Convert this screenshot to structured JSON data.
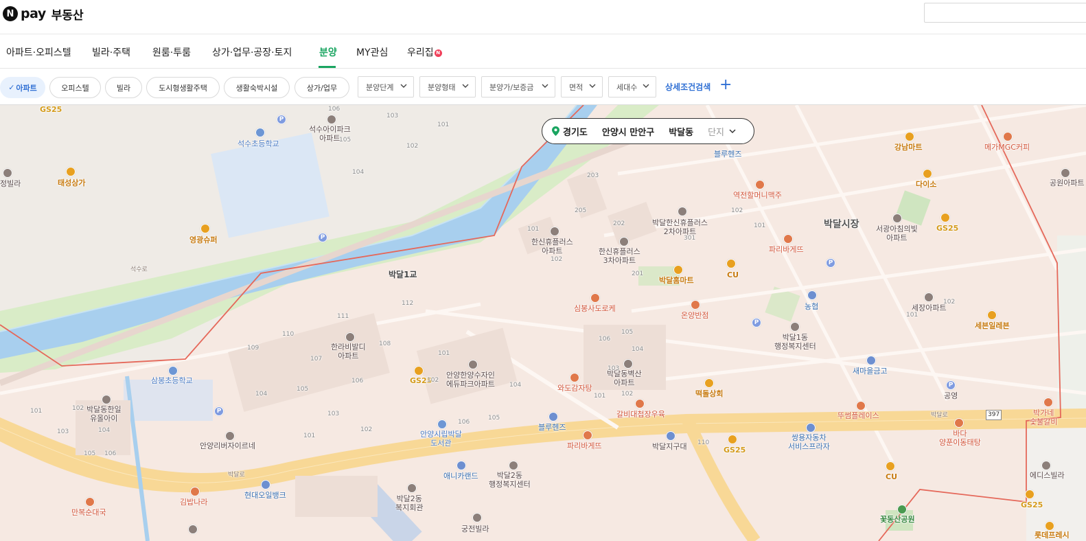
{
  "header": {
    "logo_n": "N",
    "logo_pay": "pay",
    "logo_title": "부동산",
    "search_placeholder": ""
  },
  "nav": {
    "items": [
      {
        "label": "아파트·오피스텔"
      },
      {
        "label": "빌라·주택"
      },
      {
        "label": "원룸·투룸"
      },
      {
        "label": "상가·업무·공장·토지"
      },
      {
        "label": "분양",
        "active": true
      },
      {
        "label": "MY관심"
      },
      {
        "label": "우리집",
        "badge": "N"
      }
    ]
  },
  "filters": {
    "types": [
      {
        "label": "아파트",
        "selected": true
      },
      {
        "label": "오피스텔"
      },
      {
        "label": "빌라"
      },
      {
        "label": "도시형생활주택"
      },
      {
        "label": "생활숙박시설"
      },
      {
        "label": "상가/업무"
      }
    ],
    "dropdowns": [
      {
        "label": "분양단계"
      },
      {
        "label": "분양형태"
      },
      {
        "label": "분양가/보증금"
      },
      {
        "label": "면적"
      },
      {
        "label": "세대수"
      }
    ],
    "detail_search": "상세조건검색",
    "accent": "#2f6fd4"
  },
  "location": {
    "province": "경기도",
    "city": "안양시 만안구",
    "dong": "박달동",
    "mode": "단지"
  },
  "map": {
    "labels": {
      "gs25_1": "GS25",
      "gs25_2": "GS25",
      "gs25_3": "GS25",
      "gs25_4": "GS25",
      "gs25_5": "GS25",
      "seoksu_school": "석수초등학교",
      "seoksu_ipark": "석수아이파크\n아파트",
      "taesung": "태성상가",
      "jeongbilla": "정빌라",
      "younggwang": "영광슈퍼",
      "bakdal1gyo": "박달1교",
      "hansin_apt": "한신휴플러스\n아파트",
      "hansin3": "한신휴플러스\n3차아파트",
      "bakdal_hansin2": "박달한신휴플러스\n2차아파트",
      "bakdal_home": "박달홈마트",
      "cu1": "CU",
      "cu2": "CU",
      "simbong": "심봉사도로케",
      "onyang": "온양반점",
      "nonghyup": "농협",
      "bakdal1dong": "박달1동\n행정복지센터",
      "saemaeul": "새마을금고",
      "bakdal_market": "박달시장",
      "seoguang": "서광아침의빛\n아파트",
      "sejang": "세장아파트",
      "seven": "세븐일레븐",
      "dasso": "다이소",
      "gangnam": "강남마트",
      "mega": "메가MGC커피",
      "gongwon": "공원아파트",
      "bluehens1": "블루헨즈",
      "yeokjeon": "역전할머니맥주",
      "paris1": "파리바게뜨",
      "paris2": "파리바게뜨",
      "samsung_school": "삼봉초등학교",
      "bakdal_hanil": "박달동한일\n유올아이",
      "hanra": "한라비발디\n아파트",
      "anyang_hanyang": "안양한양수자인\n에듀파크아파트",
      "bakdal_byeoksan": "박달동벽산\n아파트",
      "wado": "와도감자탕",
      "galbi": "갈비대첩장우육",
      "ddeokdol": "떡돌상회",
      "tous": "뚜썸플레이스",
      "ssangyong": "쌍용자동차\n서비스프라자",
      "gongyoung": "공영",
      "bakganae": "박가네\n숯불갈비",
      "bada": "바다\n양푼이동태탕",
      "anyang_library": "안양시립박달\n도서관",
      "bluehens2": "블루헨즈",
      "anyang_river": "안양리버자이르네",
      "bakdal_jigu": "박달지구대",
      "animal": "애니카랜드",
      "bakdal2dong": "박달2동\n행정복지센터",
      "bakdal2_welfare": "박달2동\n복지회관",
      "gungjeon": "궁전빌라",
      "hyundai_oil": "현대오일뱅크",
      "gimbap": "김밥나라",
      "mansun": "만복순대국",
      "edis": "에디스빌라",
      "flower_park": "꽃동산공원",
      "lotte": "롯데프레시",
      "road_bakdal": "박달로",
      "road_bakdal2": "박달로",
      "road_seoksu": "석수로",
      "road_397": "397"
    }
  }
}
